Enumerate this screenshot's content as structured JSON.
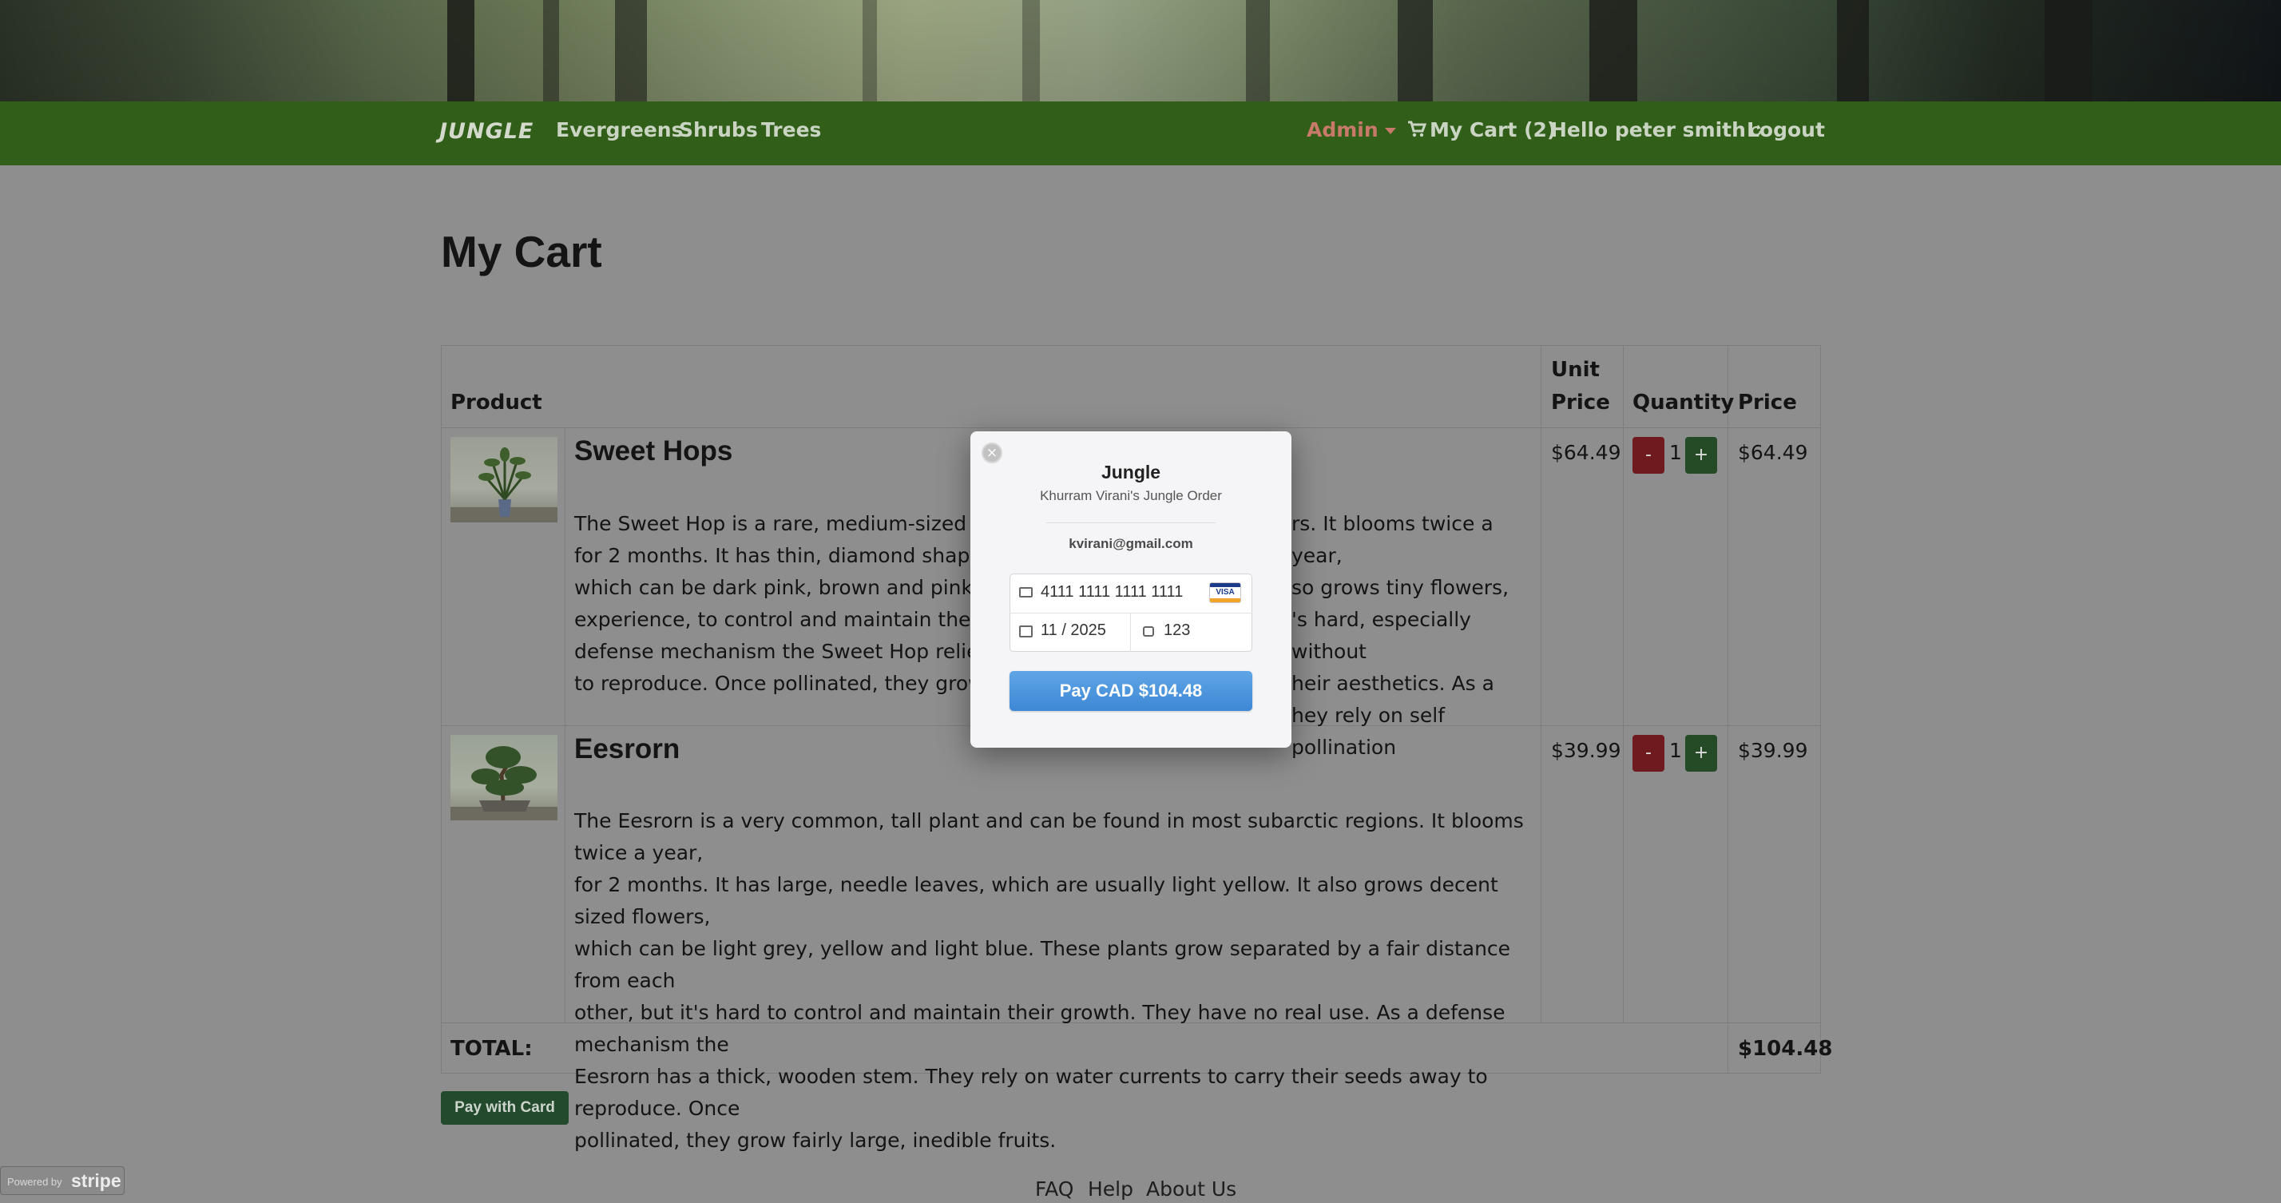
{
  "navbar": {
    "brand": "JUNGLE",
    "links": [
      "Evergreens",
      "Shrubs",
      "Trees"
    ],
    "admin": "Admin",
    "cart": "My Cart (2)",
    "greeting": "Hello peter smith",
    "logout": "Logout"
  },
  "page": {
    "title": "My Cart"
  },
  "table": {
    "headers": {
      "product": "Product",
      "unit_price": "Unit Price",
      "unit_price_line1": "Unit",
      "unit_price_line2": "Price",
      "quantity": "Quantity",
      "price": "Price"
    },
    "rows": [
      {
        "name": "Sweet Hops",
        "description": "The Sweet Hop is a rare, medium-sized plant",
        "description_right": "rs. It blooms twice a year,",
        "lines_left": [
          "The Sweet Hop is a rare, medium-sized plant",
          "for 2 months. It has thin, diamond shaped lea",
          "which can be dark pink, brown and pink. The",
          "experience, to control and maintain their gro",
          "defense mechanism the Sweet Hop relies mo",
          "to reproduce. Once pollinated, they grow fair"
        ],
        "lines_right": [
          "rs. It blooms twice a year,",
          "so grows tiny flowers,",
          "'s hard, especially without",
          "heir aesthetics. As a",
          "hey rely on self pollination",
          ""
        ],
        "unit_price": "$64.49",
        "quantity": "1",
        "price": "$64.49"
      },
      {
        "name": "Eesrorn",
        "lines": [
          "The Eesrorn is a very common, tall plant and can be found in most subarctic regions. It blooms twice a year,",
          "for 2 months. It has large, needle leaves, which are usually light yellow. It also grows decent sized flowers,",
          "which can be light grey, yellow and light blue. These plants grow separated by a fair distance from each",
          "other, but it's hard to control and maintain their growth. They have no real use. As a defense mechanism the",
          "Eesrorn has a thick, wooden stem. They rely on water currents to carry their seeds away to reproduce. Once",
          "pollinated, they grow fairly large, inedible fruits."
        ],
        "unit_price": "$39.99",
        "quantity": "1",
        "price": "$39.99"
      }
    ],
    "minus_label": "-",
    "plus_label": "+",
    "total_label": "TOTAL:",
    "total_value": "$104.48"
  },
  "pay_with_card": "Pay with Card",
  "footer": {
    "links": [
      "FAQ",
      "Help",
      "About Us"
    ]
  },
  "stripe_badge": {
    "powered_by": "Powered by",
    "brand": "stripe"
  },
  "checkout_modal": {
    "close": "×",
    "title": "Jungle",
    "subtitle": "Khurram Virani's Jungle Order",
    "email": "kvirani@gmail.com",
    "card_number": "4111 1111 1111 1111",
    "card_brand": "VISA",
    "expiry": "11 / 2025",
    "cvc": "123",
    "pay_button": "Pay CAD $104.48"
  }
}
